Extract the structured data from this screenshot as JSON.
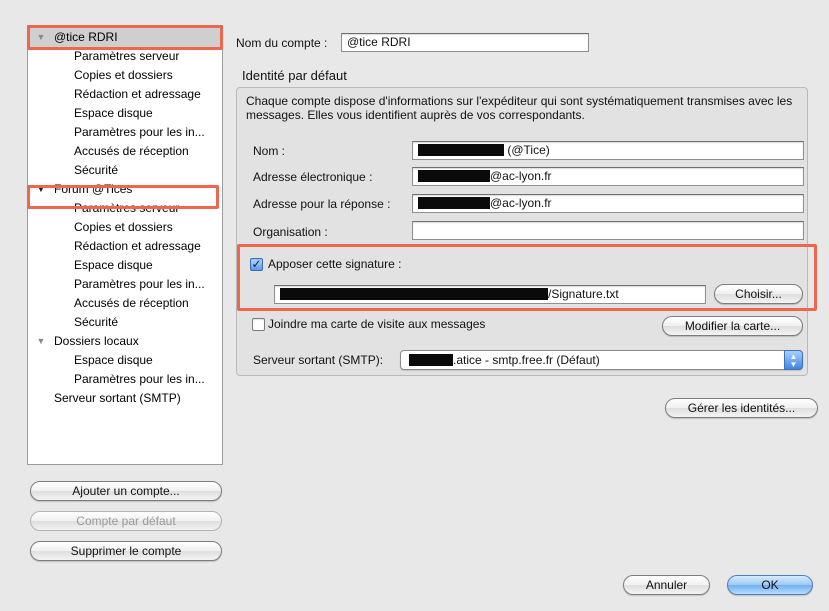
{
  "sidebar": {
    "items": [
      {
        "label": "@tice RDRI",
        "level": 0,
        "expanded": true,
        "selected": true
      },
      {
        "label": "Paramètres serveur",
        "level": 1
      },
      {
        "label": "Copies et dossiers",
        "level": 1
      },
      {
        "label": "Rédaction et adressage",
        "level": 1
      },
      {
        "label": "Espace disque",
        "level": 1
      },
      {
        "label": "Paramètres pour les in...",
        "level": 1
      },
      {
        "label": "Accusés de réception",
        "level": 1
      },
      {
        "label": "Sécurité",
        "level": 1
      },
      {
        "label": "Forum @Tices",
        "level": 0,
        "expanded": true
      },
      {
        "label": "Paramètres serveur",
        "level": 1
      },
      {
        "label": "Copies et dossiers",
        "level": 1
      },
      {
        "label": "Rédaction et adressage",
        "level": 1
      },
      {
        "label": "Espace disque",
        "level": 1
      },
      {
        "label": "Paramètres pour les in...",
        "level": 1
      },
      {
        "label": "Accusés de réception",
        "level": 1
      },
      {
        "label": "Sécurité",
        "level": 1
      },
      {
        "label": "Dossiers locaux",
        "level": 0,
        "expanded": true
      },
      {
        "label": "Espace disque",
        "level": 1
      },
      {
        "label": "Paramètres pour les in...",
        "level": 1
      },
      {
        "label": "Serveur sortant (SMTP)",
        "level": 0
      }
    ],
    "buttons": {
      "add": "Ajouter un compte...",
      "default": "Compte par défaut",
      "delete": "Supprimer le compte"
    }
  },
  "account": {
    "name_label": "Nom du compte :",
    "name_value": "@tice RDRI"
  },
  "identity": {
    "section_title": "Identité par défaut",
    "description": "Chaque compte dispose d'informations sur l'expéditeur qui sont systématiquement transmises avec les messages. Elles vous identifient auprès de vos correspondants.",
    "name_label": "Nom :",
    "name_suffix": "(@Tice)",
    "email_label": "Adresse électronique :",
    "email_suffix": "@ac-lyon.fr",
    "reply_label": "Adresse pour la réponse :",
    "reply_suffix": "@ac-lyon.fr",
    "org_label": "Organisation :",
    "org_value": ""
  },
  "signature": {
    "checkbox_label": "Apposer cette signature :",
    "checked": true,
    "path_suffix": "/Signature.txt",
    "choose_button": "Choisir..."
  },
  "vcard": {
    "checkbox_label": "Joindre ma carte de visite aux messages",
    "checked": false,
    "edit_button": "Modifier la carte..."
  },
  "smtp": {
    "label": "Serveur sortant (SMTP):",
    "selected_suffix": ".atice - smtp.free.fr (Défaut)"
  },
  "manage_identities_button": "Gérer les identités...",
  "footer": {
    "cancel": "Annuler",
    "ok": "OK"
  },
  "colors": {
    "highlight": "#ec6650",
    "selection": "#cfcfcf",
    "default_button": "#6fb0ef"
  }
}
